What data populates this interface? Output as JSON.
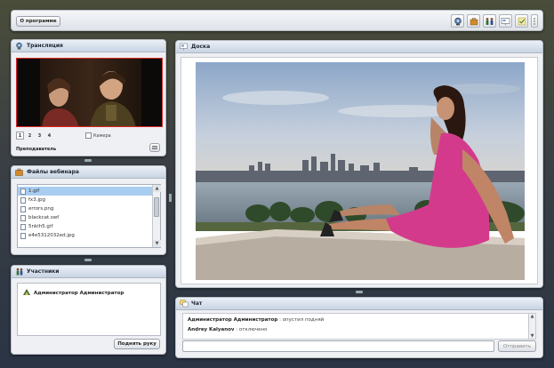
{
  "toolbar": {
    "about_label": "О программе",
    "icons": [
      "webcam-icon",
      "briefcase-icon",
      "users-icon",
      "presentation-icon",
      "settings-check-icon",
      "more-icon"
    ]
  },
  "broadcast": {
    "title": "Трансляция",
    "tabs": [
      "1",
      "2",
      "3",
      "4"
    ],
    "active_tab": "1",
    "camera_label": "Камера",
    "teacher_label": "Преподаватель"
  },
  "files": {
    "title": "Файлы вебинара",
    "items": [
      "1.gif",
      "fx3.jpg",
      "errors.png",
      "blackcat.swf",
      "5nkih5.gif",
      "e4e5312032ed.jpg"
    ],
    "selected_index": 0
  },
  "participants": {
    "title": "Участники",
    "items": [
      "Администратор Администратор"
    ],
    "raise_hand_label": "Поднять руку"
  },
  "board": {
    "title": "Доска"
  },
  "chat": {
    "title": "Чат",
    "messages": [
      {
        "author": "Администратор Администратор",
        "text": "опустил подняй"
      },
      {
        "author": "Andrey Kalyanov",
        "text": "отключено"
      }
    ],
    "input_value": "",
    "send_label": "Отправить"
  },
  "colors": {
    "video_border": "#dd2222",
    "selected_file": "#a8cdf0",
    "header_gradient_top": "#eaf0f7",
    "header_gradient_bottom": "#c9d4e3"
  }
}
